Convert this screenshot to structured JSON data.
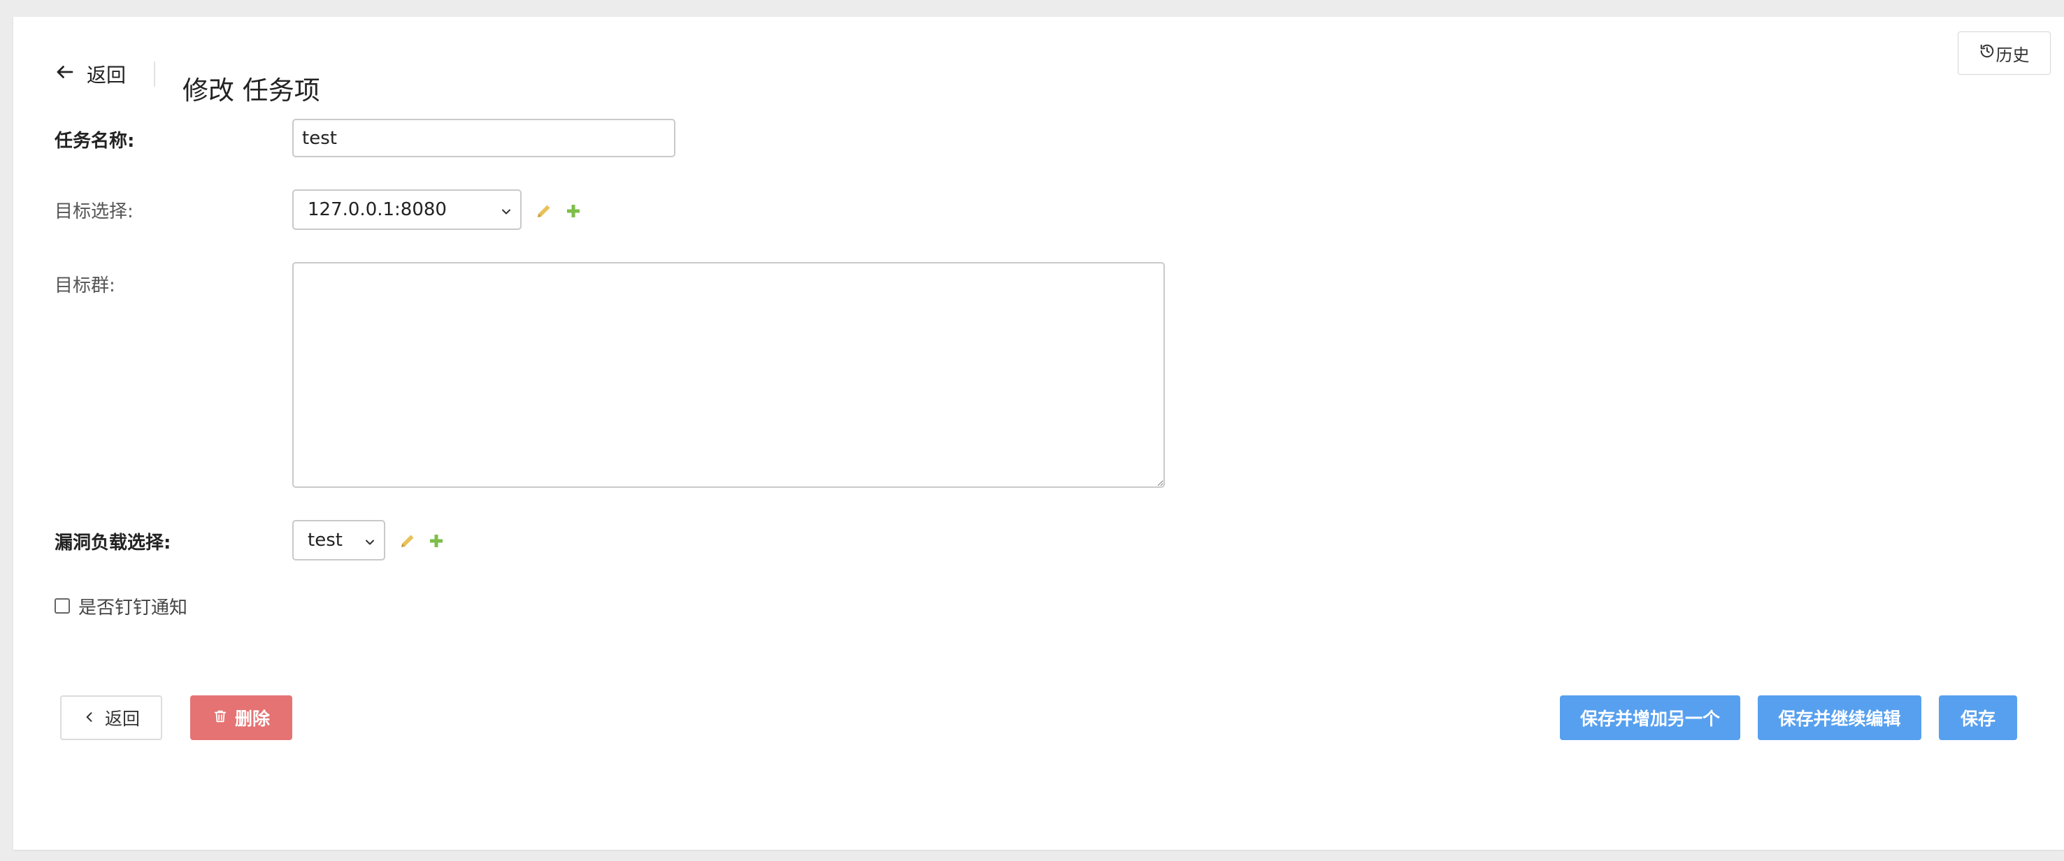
{
  "header": {
    "back_label": "返回",
    "title": "修改 任务项",
    "history_label": "历史"
  },
  "form": {
    "task_name": {
      "label": "任务名称:",
      "value": "test"
    },
    "target_select": {
      "label": "目标选择:",
      "selected": "127.0.0.1:8080"
    },
    "target_group": {
      "label": "目标群:",
      "value": ""
    },
    "payload_select": {
      "label": "漏洞负载选择:",
      "selected": "test"
    },
    "dingtalk_notify": {
      "label": "是否钉钉通知",
      "checked": false
    }
  },
  "actions": {
    "back_label": "返回",
    "delete_label": "删除",
    "save_add_another_label": "保存并增加另一个",
    "save_continue_label": "保存并继续编辑",
    "save_label": "保存"
  },
  "colors": {
    "primary": "#57a0ef",
    "danger": "#e57373",
    "edit_icon": "#e8c15a",
    "add_icon": "#7cbf4a"
  },
  "icons": {
    "history": "history-icon",
    "back": "arrow-left-icon",
    "edit": "pencil-icon",
    "add": "plus-icon",
    "delete": "trash-icon",
    "chevron": "chevron-left-icon",
    "caret": "chevron-down-icon"
  }
}
